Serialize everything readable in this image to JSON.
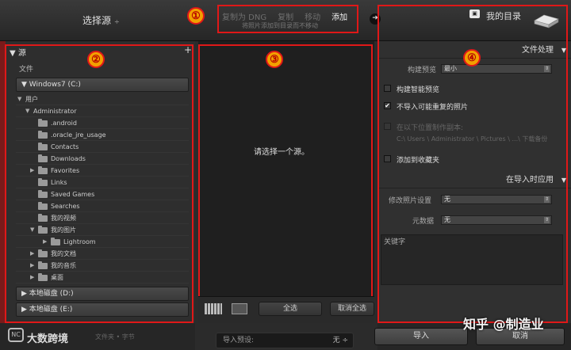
{
  "topbar": {
    "source_label": "选择源",
    "source_caret": "÷",
    "modes": [
      "复制为 DNG",
      "复制",
      "移动",
      "添加"
    ],
    "active_mode": "添加",
    "mode_hint": "将照片添加到目录而不移动",
    "catalog_label": "我的目录"
  },
  "badges": [
    "①",
    "②",
    "③",
    "④"
  ],
  "left": {
    "header": "源",
    "plus": "+",
    "files_label": "文件",
    "drive_c": "Windows7 (C:)",
    "tree": [
      {
        "label": "用户",
        "level": 0,
        "expanded": true
      },
      {
        "label": "Administrator",
        "level": 1,
        "expanded": true
      },
      {
        "label": ".android",
        "level": 2,
        "expanded": false
      },
      {
        "label": ".oracle_jre_usage",
        "level": 2,
        "expanded": false
      },
      {
        "label": "Contacts",
        "level": 2,
        "expanded": false
      },
      {
        "label": "Downloads",
        "level": 2,
        "expanded": false
      },
      {
        "label": "Favorites",
        "level": 2,
        "expanded": false,
        "has_children": true
      },
      {
        "label": "Links",
        "level": 2,
        "expanded": false
      },
      {
        "label": "Saved Games",
        "level": 2,
        "expanded": false
      },
      {
        "label": "Searches",
        "level": 2,
        "expanded": false
      },
      {
        "label": "我的视频",
        "level": 2,
        "expanded": false
      },
      {
        "label": "我的图片",
        "level": 2,
        "expanded": true,
        "has_children": true
      },
      {
        "label": "Lightroom",
        "level": 3,
        "expanded": false,
        "has_children": true
      },
      {
        "label": "我的文档",
        "level": 2,
        "expanded": false,
        "has_children": true
      },
      {
        "label": "我的音乐",
        "level": 2,
        "expanded": false,
        "has_children": true
      },
      {
        "label": "桌面",
        "level": 2,
        "expanded": false,
        "has_children": true
      }
    ],
    "drive_d": "本地磁盘 (D:)",
    "drive_e": "本地磁盘 (E:)"
  },
  "center": {
    "message": "请选择一个源。",
    "select_all": "全选",
    "deselect_all": "取消全选"
  },
  "right": {
    "file_handling_header": "文件处理",
    "build_previews_label": "构建预览",
    "build_previews_value": "最小",
    "smart_previews_label": "构建智能预览",
    "smart_previews_checked": false,
    "dont_import_dupes_label": "不导入可能重复的照片",
    "dont_import_dupes_checked": true,
    "second_copy_label": "在以下位置制作副本:",
    "second_copy_path": "C:\\ Users \\ Administrator \\ Pictures \\ ...\\ 下载备份",
    "add_collection_label": "添加到收藏夹",
    "apply_header": "在导入时应用",
    "develop_label": "修改照片设置",
    "develop_value": "无",
    "metadata_label": "元数据",
    "metadata_value": "无",
    "keywords_label": "关键字"
  },
  "footer": {
    "brand": "大数跨境",
    "brand_logo": "NC",
    "brand_sub": "文件夹 • 字节",
    "preset_label": "导入预设:",
    "preset_value": "无 ÷",
    "import_button": "导入",
    "cancel_button": "取消",
    "watermark": "知乎 @制造业"
  },
  "colors": {
    "annotation_red": "#e01818",
    "badge_orange": "#f2a000"
  }
}
